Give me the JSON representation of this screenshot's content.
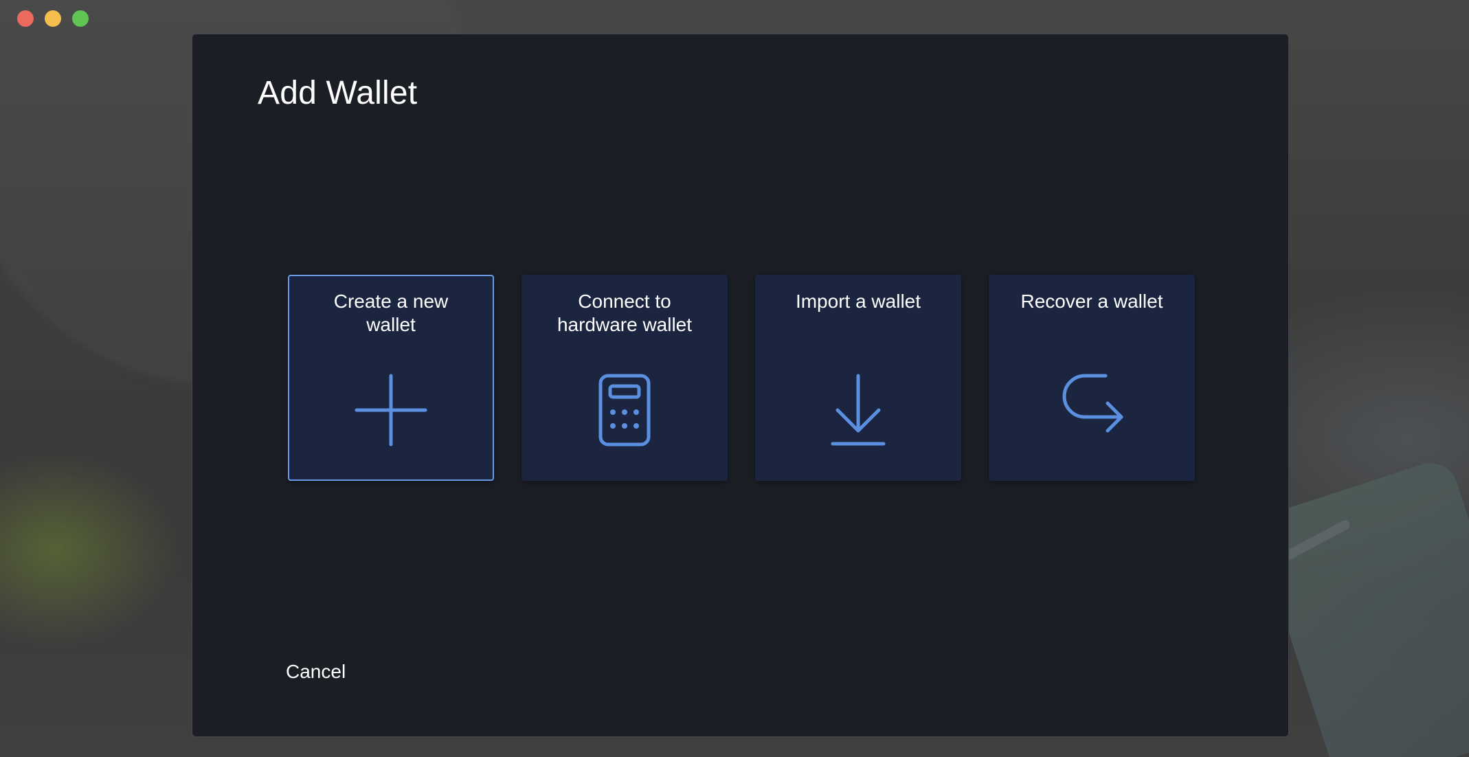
{
  "window": {
    "controls": [
      "close",
      "minimize",
      "maximize"
    ]
  },
  "dialog": {
    "title": "Add Wallet",
    "cancel_label": "Cancel",
    "cards": [
      {
        "label": "Create a new wallet",
        "icon": "plus-icon",
        "selected": true
      },
      {
        "label": "Connect to hardware wallet",
        "icon": "calculator-icon",
        "selected": false
      },
      {
        "label": "Import a wallet",
        "icon": "download-icon",
        "selected": false
      },
      {
        "label": "Recover a wallet",
        "icon": "redo-arrow-icon",
        "selected": false
      }
    ]
  },
  "colors": {
    "dialog_bg": "#1b1e25",
    "card_bg": "#1b2540",
    "accent": "#5b8fe0",
    "selected_border": "#6a9be6"
  }
}
